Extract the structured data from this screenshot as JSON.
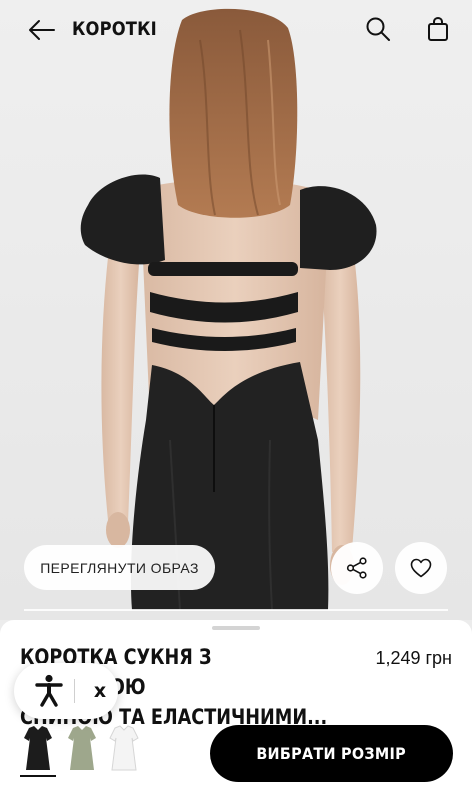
{
  "header": {
    "back_icon": "arrow-left-icon",
    "title": "КОРОТКІ",
    "search_icon": "search-icon",
    "bag_icon": "shopping-bag-icon"
  },
  "hero": {
    "view_outfit_label": "ПЕРЕГЛЯНУТИ ОБРАЗ",
    "share_icon": "share-icon",
    "wishlist_icon": "heart-icon"
  },
  "product": {
    "name_line1": "КОРОТКА СУКНЯ З ВІДКРИТОЮ",
    "name_line2": "СПИНОЮ ТА ЕЛАСТИЧНИМИ...",
    "price": "1,249 грн",
    "colors": [
      {
        "name": "black",
        "hex": "#1c1c1c"
      },
      {
        "name": "sage",
        "hex": "#9ea78c"
      },
      {
        "name": "white",
        "hex": "#f4f4f4"
      }
    ],
    "select_size_label": "ВИБРАТИ РОЗМІР"
  },
  "accessibility": {
    "icon": "accessibility-person-icon",
    "close_label": "x"
  }
}
